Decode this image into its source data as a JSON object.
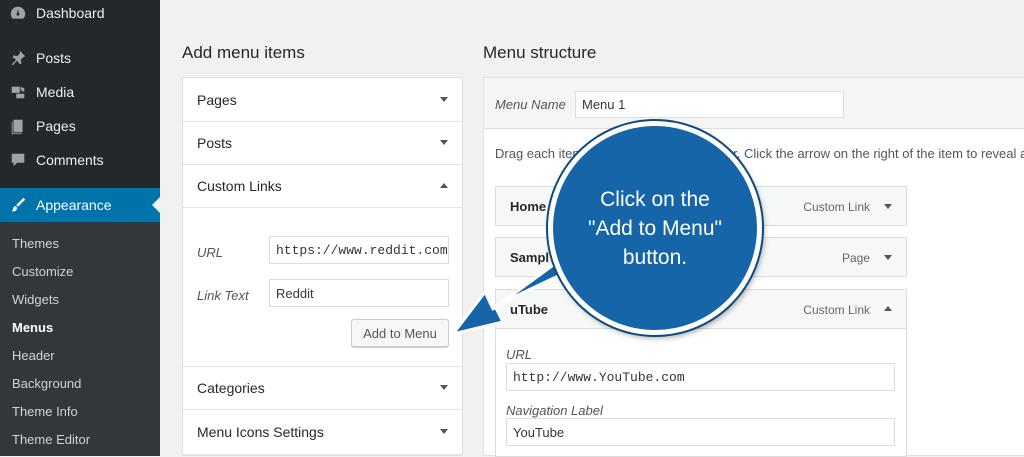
{
  "sidebar": {
    "items": [
      {
        "label": "Dashboard",
        "icon": "dashboard-icon"
      },
      {
        "label": "Posts",
        "icon": "pin-icon"
      },
      {
        "label": "Media",
        "icon": "media-icon"
      },
      {
        "label": "Pages",
        "icon": "pages-icon"
      },
      {
        "label": "Comments",
        "icon": "comments-icon"
      },
      {
        "label": "Appearance",
        "icon": "paintbrush-icon"
      }
    ],
    "submenu": [
      "Themes",
      "Customize",
      "Widgets",
      "Menus",
      "Header",
      "Background",
      "Theme Info",
      "Theme Editor"
    ],
    "current_submenu": "Menus"
  },
  "add_items": {
    "heading": "Add menu items",
    "sections": {
      "pages": "Pages",
      "posts": "Posts",
      "custom_links": "Custom Links",
      "categories": "Categories",
      "menu_icons": "Menu Icons Settings"
    },
    "custom": {
      "url_label": "URL",
      "url_value": "https://www.reddit.com",
      "link_text_label": "Link Text",
      "link_text_value": "Reddit",
      "add_button": "Add to Menu"
    }
  },
  "structure": {
    "heading": "Menu structure",
    "menu_name_label": "Menu Name",
    "menu_name_value": "Menu 1",
    "hint_left": "Drag each item",
    "hint_right": "r. Click the arrow on the right of the item to reveal ad",
    "items": [
      {
        "title": "Home",
        "kind": "Custom Link"
      },
      {
        "title": "Sampl",
        "kind": "Page"
      },
      {
        "title": "uTube",
        "kind": "Custom Link"
      }
    ],
    "open_item": {
      "url_label": "URL",
      "url_value": "http://www.YouTube.com",
      "nav_label": "Navigation Label",
      "nav_value": "YouTube"
    }
  },
  "callout": {
    "lines": [
      "Click on the",
      "\"Add to Menu\"",
      "button."
    ],
    "color": "#1565a8"
  },
  "colors": {
    "accent": "#0073aa",
    "sidebar": "#23282d"
  }
}
